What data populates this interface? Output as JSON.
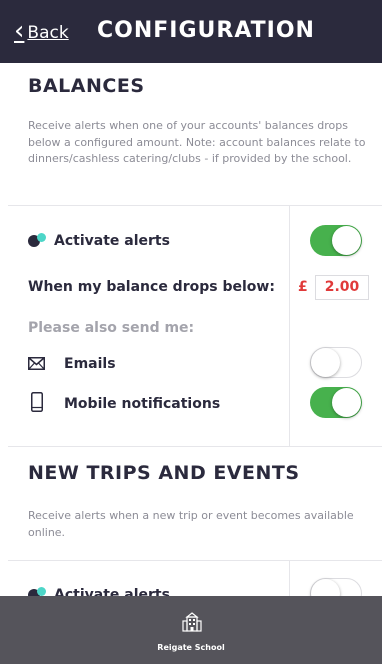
{
  "header": {
    "back_label": "Back",
    "title": "CONFIGURATION"
  },
  "balances": {
    "title": "BALANCES",
    "description": "Receive alerts when one of your accounts' balances drops below a configured amount. Note: account balances relate to dinners/cashless catering/clubs - if provided by the school.",
    "activate_label": "Activate alerts",
    "activate_on": true,
    "threshold_label": "When my balance drops below:",
    "currency": "£",
    "amount": "2.00",
    "also_send_label": "Please also send me:",
    "emails_label": "Emails",
    "emails_on": false,
    "mobile_label": "Mobile notifications",
    "mobile_on": true
  },
  "trips": {
    "title": "NEW TRIPS AND EVENTS",
    "description": "Receive alerts when a new trip or event becomes available online.",
    "activate_label": "Activate alerts",
    "activate_on": false
  },
  "footer": {
    "school_name": "Reigate School",
    "icon": "school-building-icon"
  },
  "colors": {
    "header_bg": "#2b2a3d",
    "toggle_on": "#47b14d",
    "accent_red": "#e03a3a",
    "dot_teal": "#4dd6c8",
    "footer_bg": "#55545b"
  }
}
